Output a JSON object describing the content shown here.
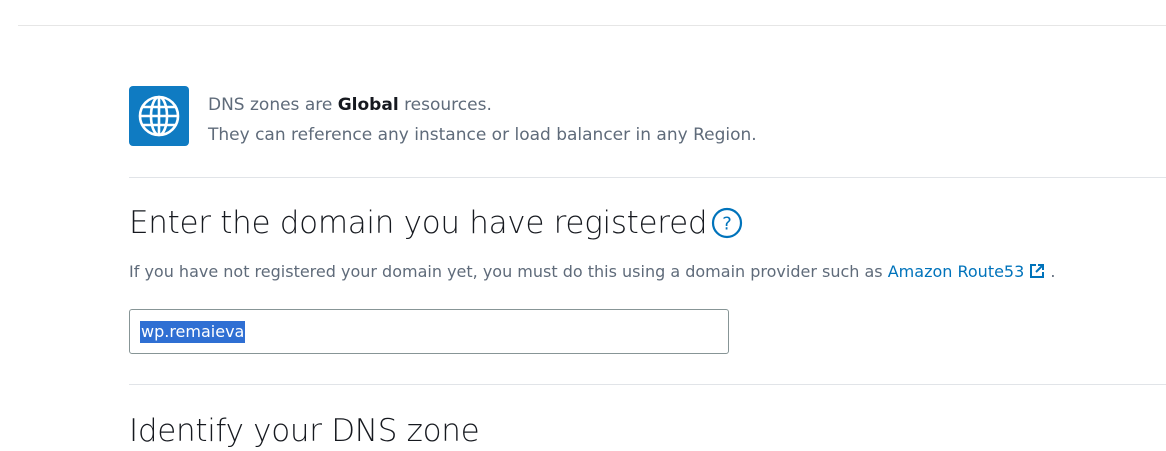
{
  "info": {
    "line1_prefix": "DNS zones are",
    "line1_bold": "Global",
    "line1_suffix": "resources.",
    "line2": "They can reference any instance or load balancer in any Region.",
    "icon": "globe-icon"
  },
  "domain_section": {
    "heading": "Enter the domain you have registered",
    "help_icon": "help-circle-icon",
    "hint_text": "If you have not registered your domain yet, you must do this using a domain provider such as",
    "hint_link": "Amazon Route53",
    "hint_end": ".",
    "input_value": "wp.remaieva"
  },
  "dns_zone_section": {
    "heading": "Identify your DNS zone"
  },
  "colors": {
    "accent": "#0f7bc2",
    "link": "#0073bb",
    "selection": "#2f6fd3"
  }
}
